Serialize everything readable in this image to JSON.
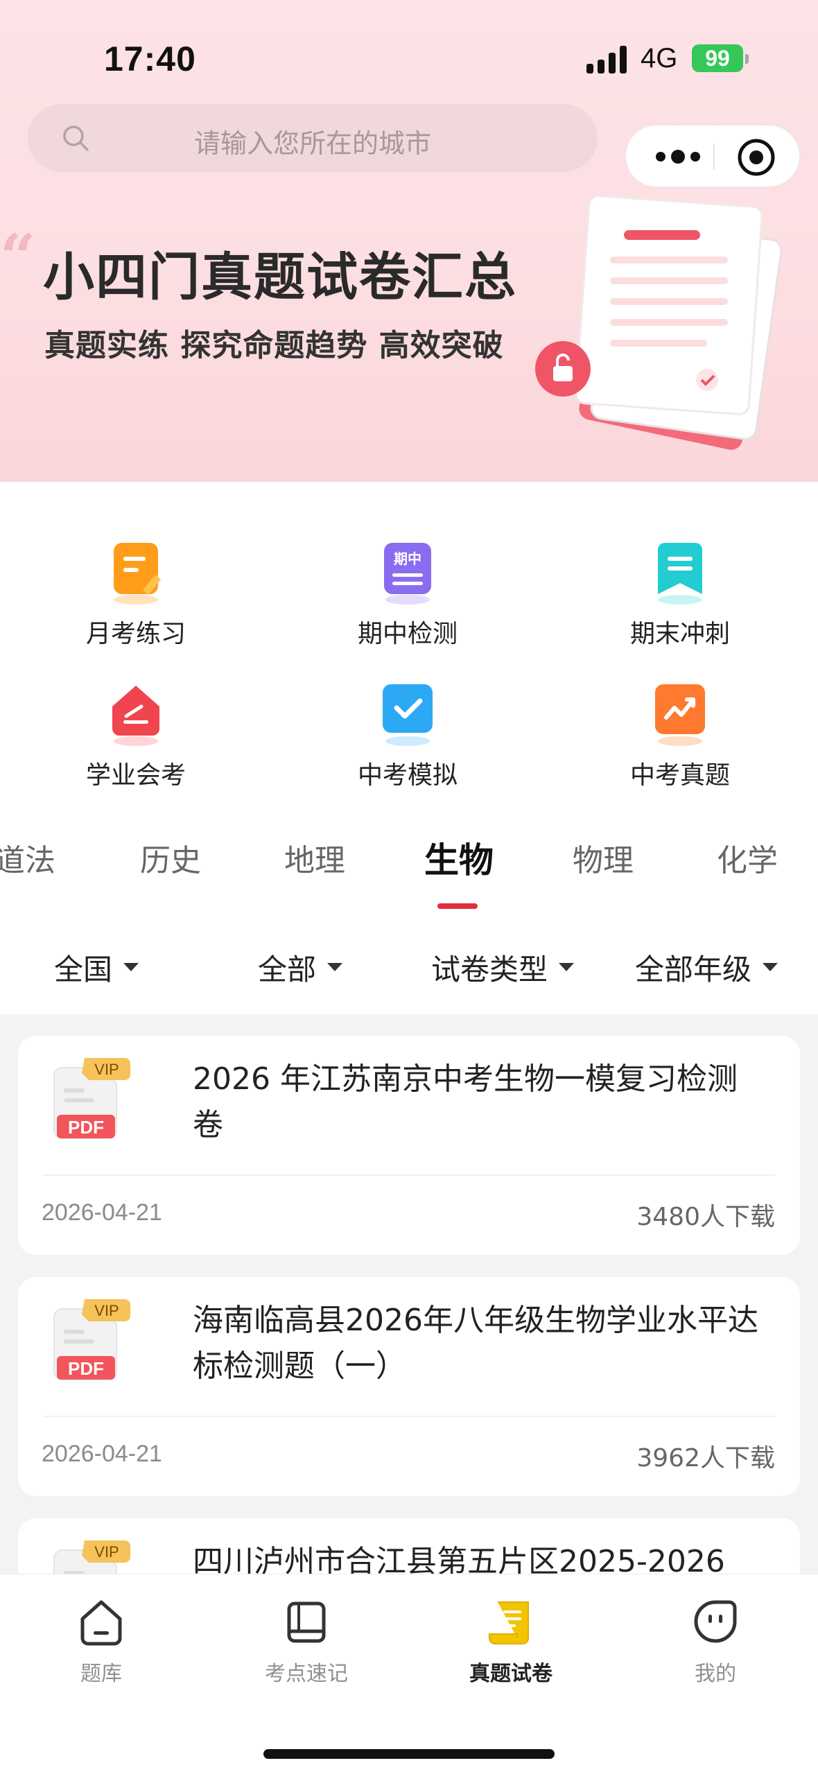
{
  "status_bar": {
    "time": "17:40",
    "network": "4G",
    "battery": "99"
  },
  "search": {
    "placeholder": "请输入您所在的城市"
  },
  "banner": {
    "title": "小四门真题试卷汇总",
    "subtitle": "真题实练 探究命题趋势 高效突破"
  },
  "categories": [
    {
      "label": "月考练习",
      "icon": "note-icon",
      "color": "#ff9d1a"
    },
    {
      "label": "期中检测",
      "icon": "midterm-icon",
      "color": "#8a6cf0",
      "icon_text": "期中"
    },
    {
      "label": "期末冲刺",
      "icon": "bookmark-icon",
      "color": "#22ccd0"
    },
    {
      "label": "学业会考",
      "icon": "home-pencil-icon",
      "color": "#f0444f"
    },
    {
      "label": "中考模拟",
      "icon": "check-icon",
      "color": "#2da8f5"
    },
    {
      "label": "中考真题",
      "icon": "trend-icon",
      "color": "#ff7a2e"
    }
  ],
  "subjects": [
    {
      "label": "道法",
      "active": false
    },
    {
      "label": "历史",
      "active": false
    },
    {
      "label": "地理",
      "active": false
    },
    {
      "label": "生物",
      "active": true
    },
    {
      "label": "物理",
      "active": false
    },
    {
      "label": "化学",
      "active": false
    }
  ],
  "filters": [
    {
      "label": "全国"
    },
    {
      "label": "全部"
    },
    {
      "label": "试卷类型"
    },
    {
      "label": "全部年级"
    }
  ],
  "papers": [
    {
      "title": "2026 年江苏南京中考生物一模复习检测卷",
      "date": "2026-04-21",
      "downloads": "3480人下载",
      "badge": "VIP",
      "file_type": "PDF"
    },
    {
      "title": "海南临高县2026年八年级生物学业水平达标检测题（一）",
      "date": "2026-04-21",
      "downloads": "3962人下载",
      "badge": "VIP",
      "file_type": "PDF"
    },
    {
      "title": "四川泸州市合江县第五片区2025-2026",
      "badge": "VIP",
      "file_type": "PDF"
    }
  ],
  "tabbar": [
    {
      "label": "题库",
      "icon": "home-icon",
      "active": false
    },
    {
      "label": "考点速记",
      "icon": "book-icon",
      "active": false
    },
    {
      "label": "真题试卷",
      "icon": "scroll-icon",
      "active": true
    },
    {
      "label": "我的",
      "icon": "profile-face-icon",
      "active": false
    }
  ],
  "colors": {
    "accent": "#e0303f",
    "tab_active": "#f5c400",
    "vip": "#f6c25a",
    "pdf": "#f2555b"
  }
}
